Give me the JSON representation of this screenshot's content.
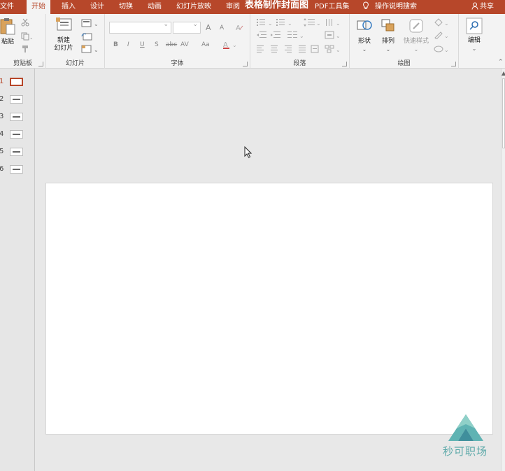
{
  "title_bar": {
    "doc_title": "表格制作封面图",
    "tabs": [
      {
        "label": "文件",
        "active": false
      },
      {
        "label": "开始",
        "active": true
      },
      {
        "label": "插入",
        "active": false
      },
      {
        "label": "设计",
        "active": false
      },
      {
        "label": "切换",
        "active": false
      },
      {
        "label": "动画",
        "active": false
      },
      {
        "label": "幻灯片放映",
        "active": false
      },
      {
        "label": "审阅",
        "active": false
      },
      {
        "label": "PDF工具集",
        "active": false
      }
    ],
    "tell_me": "操作说明搜索",
    "share": "共享"
  },
  "ribbon": {
    "clipboard": {
      "paste": "粘贴",
      "label": "剪贴板"
    },
    "slides": {
      "new_slide_line1": "新建",
      "new_slide_line2": "幻灯片",
      "label": "幻灯片"
    },
    "font": {
      "label": "字体",
      "bold": "B",
      "italic": "I",
      "underline": "U",
      "shadow": "S",
      "strike": "abc",
      "spacing": "AV",
      "case": "Aa",
      "grow": "A",
      "shrink": "A"
    },
    "paragraph": {
      "label": "段落"
    },
    "drawing": {
      "shapes": "形状",
      "arrange": "排列",
      "quick_styles": "快速样式",
      "label": "绘图"
    },
    "editing": {
      "label": "编辑"
    }
  },
  "thumbnails": [
    {
      "number": "1",
      "selected": true
    },
    {
      "number": "2",
      "selected": false
    },
    {
      "number": "3",
      "selected": false
    },
    {
      "number": "4",
      "selected": false
    },
    {
      "number": "5",
      "selected": false
    },
    {
      "number": "6",
      "selected": false
    }
  ],
  "watermark": {
    "text": "秒可职场"
  },
  "colors": {
    "accent": "#b7472a",
    "ribbon": "#f3f3f3",
    "workspace": "#e8e8e8"
  }
}
